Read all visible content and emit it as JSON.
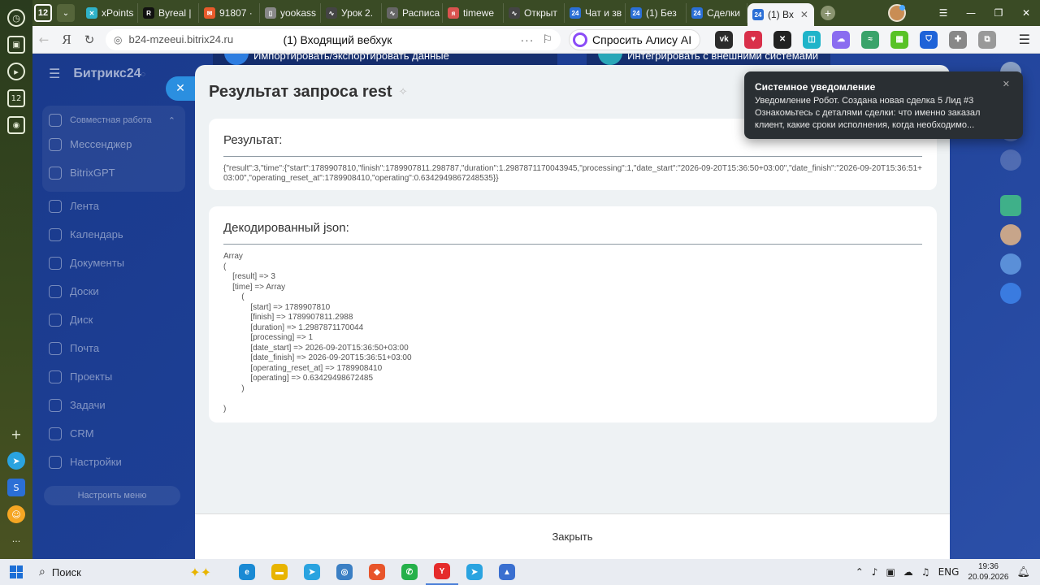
{
  "browser": {
    "tab_count": "12",
    "tabs": [
      {
        "label": "xPoints",
        "color": "#2fb2c9",
        "glyph": "✕"
      },
      {
        "label": "Byreal |",
        "color": "#111111",
        "glyph": "R"
      },
      {
        "label": "91807 ·",
        "color": "#e85a2b",
        "glyph": "✉"
      },
      {
        "label": "yookass",
        "color": "#888888",
        "glyph": "▯"
      },
      {
        "label": "Урок 2.",
        "color": "#444444",
        "glyph": "∿"
      },
      {
        "label": "Расписа",
        "color": "#666666",
        "glyph": "∿"
      },
      {
        "label": "timewe",
        "color": "#d9534f",
        "glyph": "я"
      },
      {
        "label": "Открыт",
        "color": "#444444",
        "glyph": "∿"
      },
      {
        "label": "Чат и зв",
        "color": "#2b6fd6",
        "glyph": "24"
      },
      {
        "label": "(1) Без",
        "color": "#2b6fd6",
        "glyph": "24"
      },
      {
        "label": "Сделки",
        "color": "#2b6fd6",
        "glyph": "24"
      }
    ],
    "active_tab": {
      "label": "(1) Вх",
      "color": "#2b6fd6",
      "glyph": "24"
    },
    "address": {
      "url": "b24-mzeeui.bitrix24.ru",
      "page_title": "(1) Входящий вебхук",
      "more": "···"
    },
    "alice_label": "Спросить Алису AI"
  },
  "bitrix": {
    "logo": "Битрикс24",
    "logo_mark": "◌",
    "menu_group_title": "Совместная работа",
    "menu_items": [
      "Мессенджер",
      "BitrixGPT",
      "Лента",
      "Календарь",
      "Документы",
      "Доски",
      "Диск",
      "Почта",
      "Проекты",
      "Задачи",
      "CRM",
      "Настройки"
    ],
    "config_label": "Настроить меню",
    "top_cards": [
      "Импортировать/экспортировать данные",
      "Интегрировать с внешними системами"
    ]
  },
  "panel": {
    "title": "Результат запроса rest",
    "result_heading": "Результат:",
    "result_raw": "{\"result\":3,\"time\":{\"start\":1789907810,\"finish\":1789907811.298787,\"duration\":1.2987871170043945,\"processing\":1,\"date_start\":\"2026-09-20T15:36:50+03:00\",\"date_finish\":\"2026-09-20T15:36:51+03:00\",\"operating_reset_at\":1789908410,\"operating\":0.6342949867248535}}",
    "decoded_heading": "Декодированный json:",
    "decoded_text": "Array\n(\n    [result] => 3\n    [time] => Array\n        (\n            [start] => 1789907810\n            [finish] => 1789907811.2988\n            [duration] => 1.2987871170044\n            [processing] => 1\n            [date_start] => 2026-09-20T15:36:50+03:00\n            [date_finish] => 2026-09-20T15:36:51+03:00\n            [operating_reset_at] => 1789908410\n            [operating] => 0.63429498672485\n        )\n\n)",
    "close_label": "Закрыть"
  },
  "toast": {
    "title": "Системное уведомление",
    "body": "Уведомление Робот. Создана новая сделка 5 Лид #3 Ознакомьтесь с деталями сделки: что именно заказал клиент, какие сроки исполнения, когда необходимо..."
  },
  "taskbar": {
    "search_label": "Поиск",
    "apps": [
      {
        "name": "edge",
        "color": "#1a8ad4",
        "glyph": "e"
      },
      {
        "name": "explorer",
        "color": "#e8b400",
        "glyph": "▬"
      },
      {
        "name": "telegram",
        "color": "#2aa3e0",
        "glyph": "➤"
      },
      {
        "name": "app",
        "color": "#3b7fc4",
        "glyph": "◎"
      },
      {
        "name": "brave",
        "color": "#e8552b",
        "glyph": "◆"
      },
      {
        "name": "whatsapp",
        "color": "#25b04a",
        "glyph": "✆"
      },
      {
        "name": "yandex",
        "color": "#e52b2b",
        "glyph": "Y"
      },
      {
        "name": "telegram2",
        "color": "#2aa3e0",
        "glyph": "➤"
      },
      {
        "name": "photos",
        "color": "#3a6fd0",
        "glyph": "▲"
      }
    ],
    "lang": "ENG",
    "time": "19:36",
    "date": "20.09.2026"
  }
}
